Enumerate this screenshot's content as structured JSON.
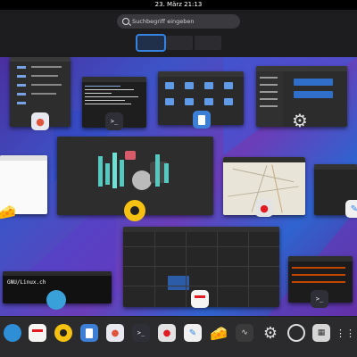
{
  "topbar": {
    "clock": "23. März 21:13"
  },
  "search": {
    "placeholder": "Suchbegriff eingeben"
  },
  "workspaces": [
    {
      "state": "active"
    },
    {
      "state": "inactive"
    },
    {
      "state": "inactive"
    }
  ],
  "windows": {
    "terminal_small": {
      "title": "GNU/Linux.ch"
    }
  },
  "dock": {
    "items": [
      "browser-icon",
      "calendar-icon",
      "music-player-icon",
      "document-viewer-icon",
      "software-center-icon",
      "terminal-icon",
      "maps-icon",
      "text-editor-icon",
      "cheese-icon",
      "system-monitor-icon",
      "settings-icon",
      "clocks-icon",
      "calculator-icon",
      "app-grid-icon"
    ]
  },
  "colors": {
    "accent": "#3584e4",
    "panel": "#000000",
    "dock": "#2b2b2e"
  }
}
